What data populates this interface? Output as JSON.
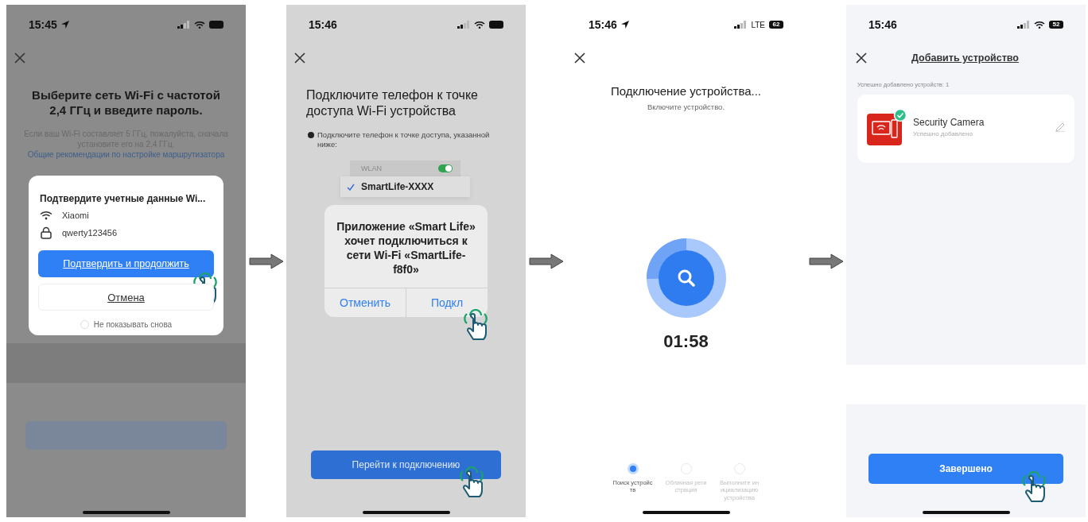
{
  "screens": [
    {
      "kind": "wifi_credentials",
      "status": {
        "time": "15:45",
        "location": true
      },
      "title": "Выберите сеть Wi-Fi с частотой 2,4 ГГц и введите пароль.",
      "hint": "Если ваш Wi-Fi составляет 5 ГГц, пожалуйста, сначала установите его на 2,4 ГГц.",
      "hint_link": "Общие рекомендации по настройке маршрутизатора",
      "dialog": {
        "title": "Подтвердите учетные данные Wi...",
        "network": "Xiaomi",
        "password": "qwerty123456",
        "confirm": {
          "label": "Подтвердить и продолжить",
          "tapped": true
        },
        "cancel": {
          "label": "Отмена",
          "tapped": false
        },
        "option": {
          "label": "Не показывать снова",
          "checked": false
        }
      }
    },
    {
      "kind": "hotspot",
      "status": {
        "time": "15:46",
        "location": false
      },
      "title": "Подключите телефон к точке доступа Wi-Fi устройства",
      "hint": "Подключите телефон к точке доступа, указанной ниже:",
      "wlan": {
        "label": "WLAN",
        "on": true
      },
      "networks": [
        {
          "name": "SmartLife-XXXX",
          "checked": true
        }
      ],
      "alert": {
        "message": "Приложение «Smart Life» хочет подключиться к сети Wi-Fi «SmartLife-f8f0»",
        "buttons": [
          {
            "label": "Отменить",
            "tapped": false
          },
          {
            "label": "Подкл",
            "tapped": true
          }
        ]
      },
      "action": {
        "label": "Перейти к подключению",
        "tapped": true
      }
    },
    {
      "kind": "connecting",
      "status": {
        "time": "15:46",
        "location": true,
        "network_label": "LTE",
        "battery": "62"
      },
      "title": "Подключение устройства...",
      "subtitle": "Включите устройство.",
      "timer": "01:58",
      "steps": [
        {
          "label": "Поиск устройств",
          "selected": true
        },
        {
          "label": "Облачная регистрация",
          "selected": false
        },
        {
          "label": "Выполните инициализацию устройства",
          "selected": false
        }
      ]
    },
    {
      "kind": "added",
      "status": {
        "time": "15:46",
        "location": false,
        "battery": "52"
      },
      "title": "Добавить устройство",
      "caption": "Успешно добавлено устройств: 1",
      "devices": [
        {
          "name": "Security Camera",
          "status": "Успешно добавлено"
        }
      ],
      "action": {
        "label": "Завершено",
        "tapped": true
      }
    }
  ]
}
